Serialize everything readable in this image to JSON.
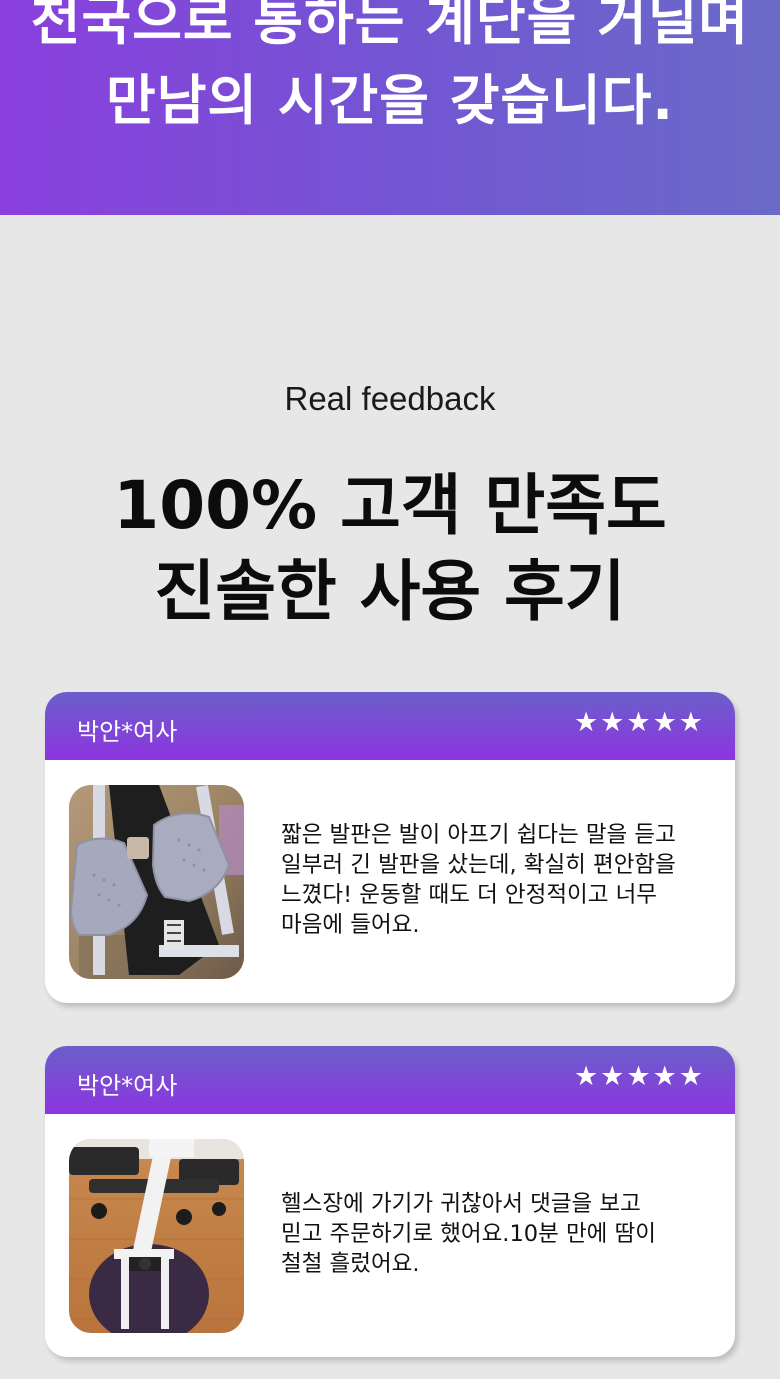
{
  "hero": {
    "line1": "천국으로 통하는 계단을 거닐며",
    "line2": "만남의 시간을 갖습니다."
  },
  "section": {
    "eyebrow": "Real feedback",
    "headline_line1": "100% 고객 만족도",
    "headline_line2": "진솔한 사용 후기"
  },
  "colors": {
    "hero_gradient_start": "#8a3fdd",
    "hero_gradient_end": "#6a6ac8",
    "card_header_top": "#6a5fc9",
    "card_header_bottom": "#8d35e0",
    "background": "#e7e7e7"
  },
  "reviews": [
    {
      "reviewer": "박안*여사",
      "stars": "★★★★★",
      "rating": 5,
      "photo_icon": "stepper-pedals-photo",
      "text": "짧은 발판은 발이 아프기 쉽다는 말을 듣고\n일부러 긴 발판을 샀는데, 확실히 편안함을\n느꼈다! 운동할 때도 더 안정적이고 너무\n마음에 들어요."
    },
    {
      "reviewer": "박안*여사",
      "stars": "★★★★★",
      "rating": 5,
      "photo_icon": "stepper-in-room-photo",
      "text": "헬스장에 가기가 귀찮아서 댓글을 보고\n믿고 주문하기로 했어요.10분 만에 땀이\n철철 흘렀어요."
    }
  ]
}
